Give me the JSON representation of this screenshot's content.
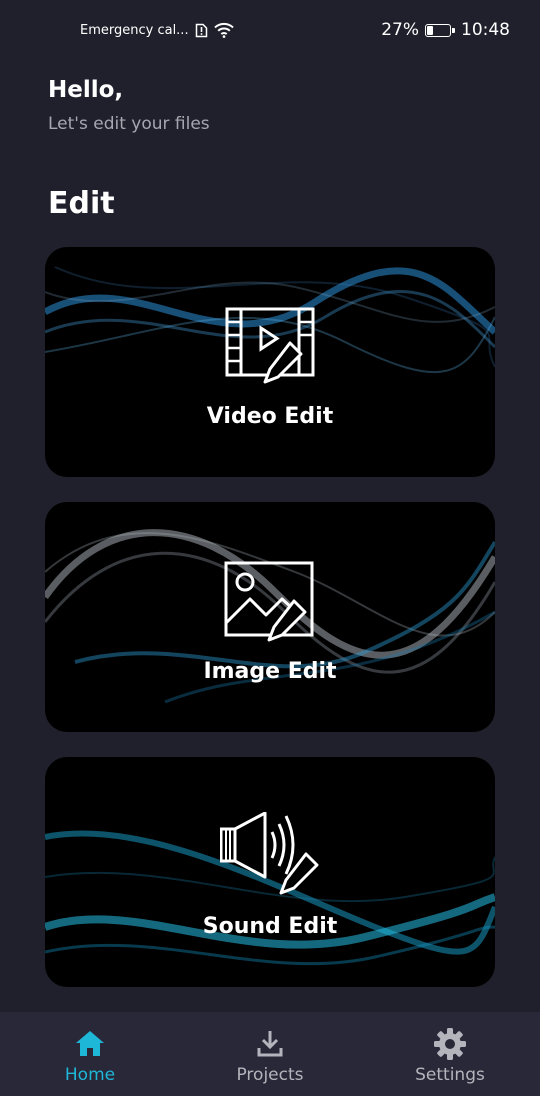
{
  "status_bar": {
    "carrier": "Emergency cal...",
    "battery_percent": "27%",
    "battery_level": 0.27,
    "time": "10:48",
    "icons": [
      "sim-alert-icon",
      "wifi-icon",
      "battery-icon"
    ]
  },
  "header": {
    "greeting": "Hello,",
    "subtitle": "Let's edit your files"
  },
  "section": {
    "title": "Edit"
  },
  "cards": [
    {
      "label": "Video Edit",
      "icon": "video-edit-icon",
      "accent": "#2a8fd8"
    },
    {
      "label": "Image Edit",
      "icon": "image-edit-icon",
      "accent": "#9aa6b2"
    },
    {
      "label": "Sound Edit",
      "icon": "sound-edit-icon",
      "accent": "#1aa8d6"
    }
  ],
  "bottom_nav": {
    "items": [
      {
        "label": "Home",
        "icon": "home-icon",
        "active": true
      },
      {
        "label": "Projects",
        "icon": "download-icon",
        "active": false
      },
      {
        "label": "Settings",
        "icon": "gear-icon",
        "active": false
      }
    ],
    "active_color": "#1fb7d8",
    "inactive_color": "#b4b4bc"
  }
}
